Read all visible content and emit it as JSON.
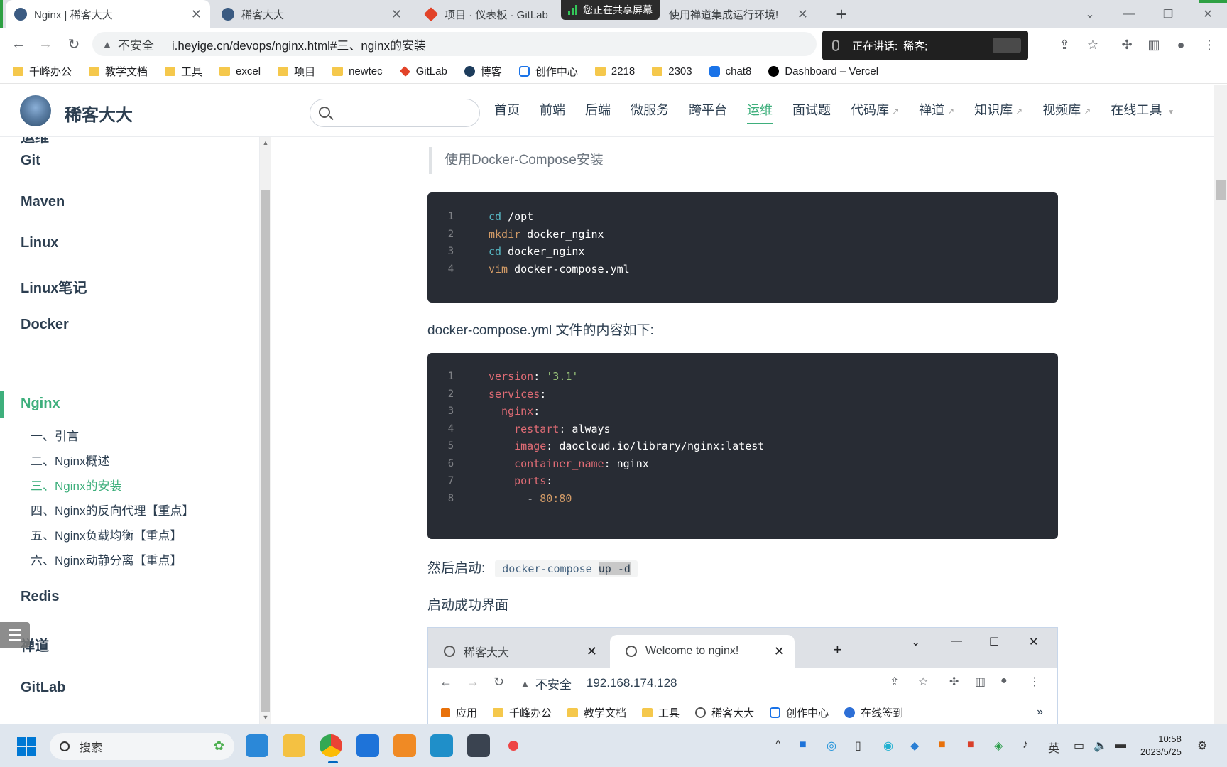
{
  "browser": {
    "tabs": [
      {
        "title": "Nginx | 稀客大大",
        "active": true,
        "icon": "site-avatar-icon"
      },
      {
        "title": "稀客大大",
        "active": false,
        "icon": "site-avatar-icon"
      },
      {
        "title": "项目 · 仪表板 · GitLab",
        "active": false,
        "icon": "gitlab-icon"
      },
      {
        "title": "使用禅道集成运行环境!",
        "active": false,
        "icon": "page-icon"
      }
    ],
    "share_banner": "您正在共享屏幕",
    "talk_popup": {
      "label": "正在讲话:",
      "speaker": "稀客;"
    },
    "address": {
      "security": "不安全",
      "url": "i.heyige.cn/devops/nginx.html#三、nginx的安装"
    },
    "bookmarks": [
      {
        "label": "千峰办公",
        "icon": "folder"
      },
      {
        "label": "教学文档",
        "icon": "folder"
      },
      {
        "label": "工具",
        "icon": "folder"
      },
      {
        "label": "excel",
        "icon": "folder"
      },
      {
        "label": "项目",
        "icon": "folder"
      },
      {
        "label": "newtec",
        "icon": "folder"
      },
      {
        "label": "GitLab",
        "icon": "gitlab"
      },
      {
        "label": "博客",
        "icon": "round"
      },
      {
        "label": "创作中心",
        "icon": "bili"
      },
      {
        "label": "2218",
        "icon": "folder"
      },
      {
        "label": "2303",
        "icon": "folder"
      },
      {
        "label": "chat8",
        "icon": "chat"
      },
      {
        "label": "Dashboard – Vercel",
        "icon": "vercel"
      }
    ]
  },
  "site": {
    "title": "稀客大大",
    "search_value": "",
    "nav": [
      {
        "label": "首页",
        "external": false,
        "active": false
      },
      {
        "label": "前端",
        "external": false,
        "active": false
      },
      {
        "label": "后端",
        "external": false,
        "active": false
      },
      {
        "label": "微服务",
        "external": false,
        "active": false
      },
      {
        "label": "跨平台",
        "external": false,
        "active": false
      },
      {
        "label": "运维",
        "external": false,
        "active": true
      },
      {
        "label": "面试题",
        "external": false,
        "active": false
      },
      {
        "label": "代码库",
        "external": true,
        "active": false
      },
      {
        "label": "禅道",
        "external": true,
        "active": false
      },
      {
        "label": "知识库",
        "external": true,
        "active": false
      },
      {
        "label": "视频库",
        "external": true,
        "active": false
      },
      {
        "label": "在线工具",
        "external": false,
        "active": false,
        "dropdown": true
      }
    ]
  },
  "sidebar": {
    "cut_group": "运维",
    "groups": [
      "Git",
      "Maven",
      "Linux",
      "Linux笔记",
      "Docker",
      "Nginx",
      "Redis",
      "禅道",
      "GitLab"
    ],
    "active_group": "Nginx",
    "nginx_items": [
      "一、引言",
      "二、Nginx概述",
      "三、Nginx的安装",
      "四、Nginx的反向代理【重点】",
      "五、Nginx负载均衡【重点】",
      "六、Nginx动静分离【重点】"
    ],
    "active_item": "三、Nginx的安装"
  },
  "content": {
    "tip": "使用Docker-Compose安装",
    "code1": [
      {
        "n": "1",
        "tokens": [
          {
            "t": "cd",
            "c": "builtin"
          },
          {
            "t": " /opt",
            "c": "plain"
          }
        ]
      },
      {
        "n": "2",
        "tokens": [
          {
            "t": "mkdir",
            "c": "cmd"
          },
          {
            "t": " docker_nginx",
            "c": "plain"
          }
        ]
      },
      {
        "n": "3",
        "tokens": [
          {
            "t": "cd",
            "c": "builtin"
          },
          {
            "t": " docker_nginx",
            "c": "plain"
          }
        ]
      },
      {
        "n": "4",
        "tokens": [
          {
            "t": "vim",
            "c": "cmd"
          },
          {
            "t": " docker-compose.yml",
            "c": "plain"
          }
        ]
      }
    ],
    "para1": "docker-compose.yml 文件的内容如下:",
    "code2": [
      {
        "n": "1",
        "tokens": [
          {
            "t": "version",
            "c": "key"
          },
          {
            "t": ": ",
            "c": "plain"
          },
          {
            "t": "'3.1'",
            "c": "str"
          }
        ]
      },
      {
        "n": "2",
        "tokens": [
          {
            "t": "services",
            "c": "key"
          },
          {
            "t": ":",
            "c": "plain"
          }
        ]
      },
      {
        "n": "3",
        "tokens": [
          {
            "t": "  nginx",
            "c": "key"
          },
          {
            "t": ":",
            "c": "plain"
          }
        ]
      },
      {
        "n": "4",
        "tokens": [
          {
            "t": "    restart",
            "c": "key"
          },
          {
            "t": ": always",
            "c": "plain"
          }
        ]
      },
      {
        "n": "5",
        "tokens": [
          {
            "t": "    image",
            "c": "key"
          },
          {
            "t": ": daocloud.io/library/nginx:latest",
            "c": "plain"
          }
        ]
      },
      {
        "n": "6",
        "tokens": [
          {
            "t": "    container_name",
            "c": "key"
          },
          {
            "t": ": nginx",
            "c": "plain"
          }
        ]
      },
      {
        "n": "7",
        "tokens": [
          {
            "t": "    ports",
            "c": "key"
          },
          {
            "t": ":",
            "c": "plain"
          }
        ]
      },
      {
        "n": "8",
        "tokens": [
          {
            "t": "      - ",
            "c": "plain"
          },
          {
            "t": "80:80",
            "c": "num"
          }
        ]
      }
    ],
    "para2": "然后启动:",
    "inline_code_a": "docker-compose ",
    "inline_code_b": "up -d",
    "para3": "启动成功界面",
    "embedded": {
      "tabs": [
        {
          "title": "稀客大大",
          "active": false
        },
        {
          "title": "Welcome to nginx!",
          "active": true
        }
      ],
      "security": "不安全",
      "url": "192.168.174.128",
      "bookmarks": [
        "应用",
        "千峰办公",
        "教学文档",
        "工具",
        "稀客大大",
        "创作中心",
        "在线签到"
      ],
      "more": "»"
    }
  },
  "taskbar": {
    "search_placeholder": "搜索",
    "ime": "英",
    "time": "10:58",
    "date": "2023/5/25"
  },
  "colors": {
    "accent": "#3eaf7c",
    "code_bg": "#282c34",
    "taskbar": "#dfe6ee"
  }
}
